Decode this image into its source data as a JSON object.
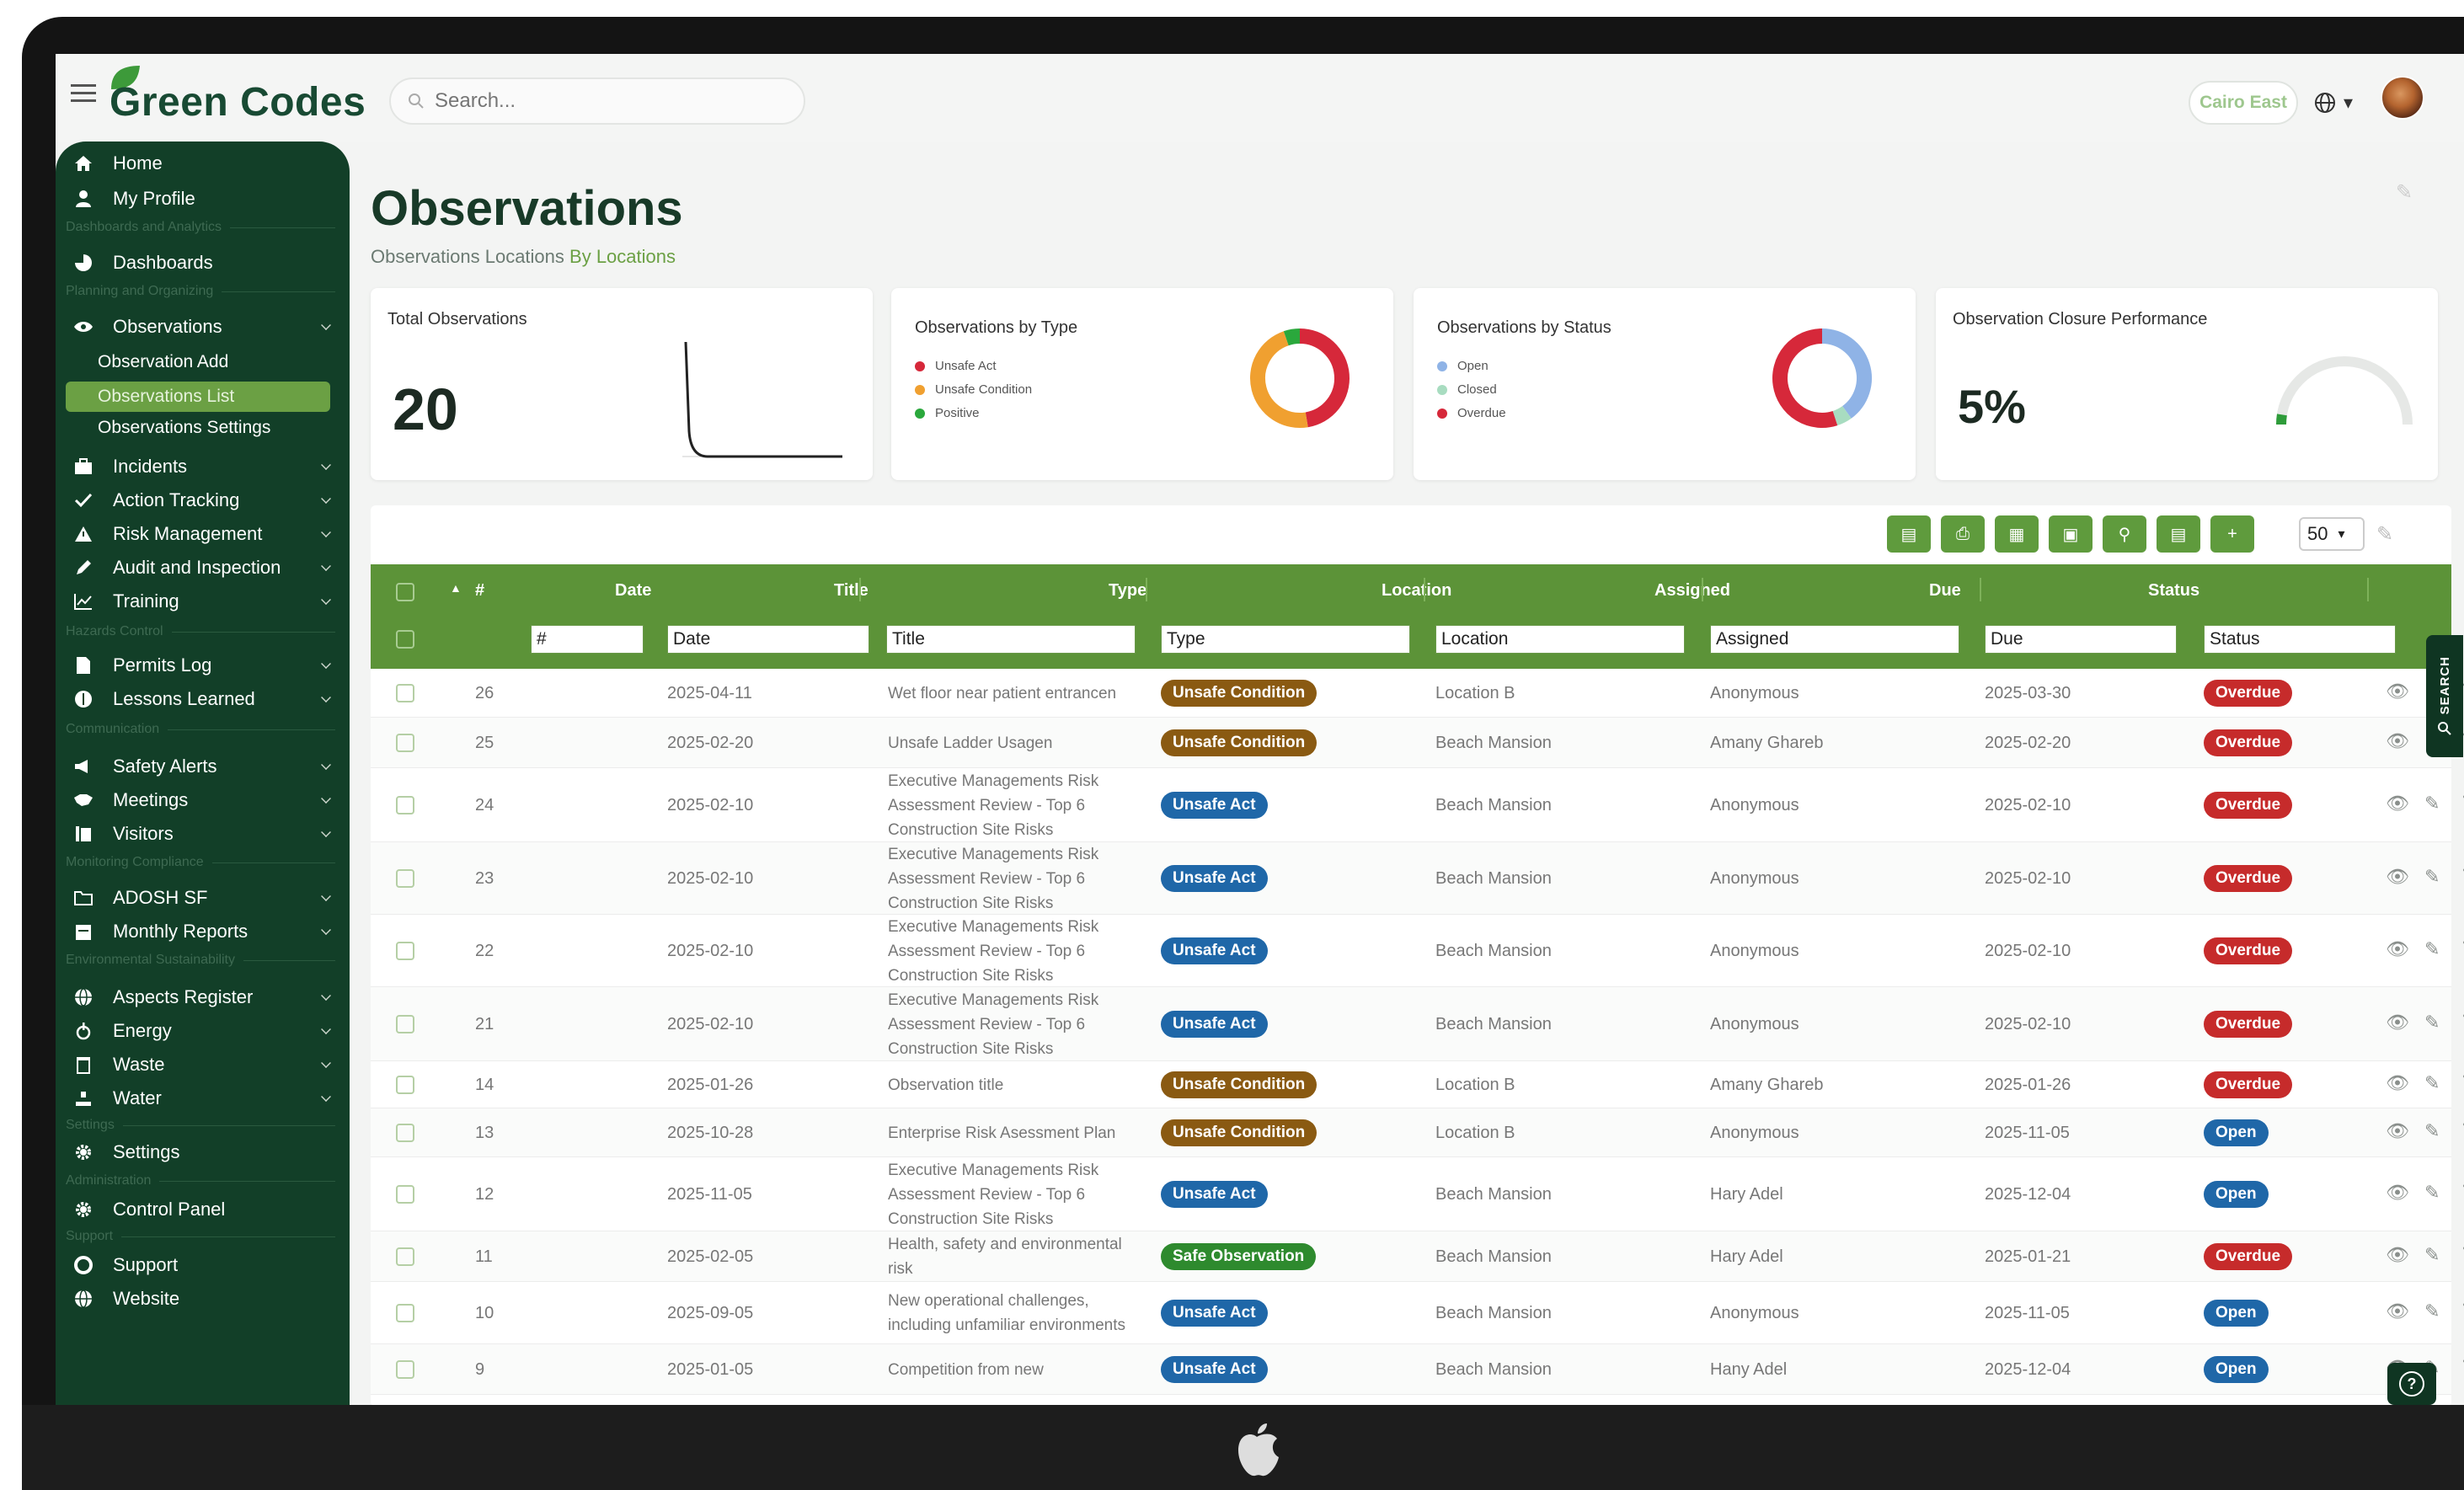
{
  "brand": {
    "name": "Green Codes"
  },
  "search": {
    "placeholder": "Search..."
  },
  "header": {
    "site": "Cairo East",
    "language_caret": "▾"
  },
  "sidebar": {
    "items": [
      {
        "label": "Home",
        "icon": "home-icon"
      },
      {
        "label": "My Profile",
        "icon": "user-icon"
      },
      {
        "label": "Dashboards",
        "icon": "dashboard-icon"
      },
      {
        "label": "Observations",
        "icon": "eye-icon"
      },
      {
        "label": "Incidents",
        "icon": "briefcase-icon"
      },
      {
        "label": "Action Tracking",
        "icon": "check-icon"
      },
      {
        "label": "Risk Management",
        "icon": "warning-icon"
      },
      {
        "label": "Audit and Inspection",
        "icon": "pen-icon"
      },
      {
        "label": "Training",
        "icon": "chart-icon"
      },
      {
        "label": "Permits Log",
        "icon": "file-icon"
      },
      {
        "label": "Lessons Learned",
        "icon": "lightbulb-icon"
      },
      {
        "label": "Safety Alerts",
        "icon": "megaphone-icon"
      },
      {
        "label": "Meetings",
        "icon": "handshake-icon"
      },
      {
        "label": "Visitors",
        "icon": "visitor-icon"
      },
      {
        "label": "ADOSH SF",
        "icon": "folder-icon"
      },
      {
        "label": "Monthly Reports",
        "icon": "calendar-icon"
      },
      {
        "label": "Aspects Register",
        "icon": "globe-icon"
      },
      {
        "label": "Energy",
        "icon": "energy-icon"
      },
      {
        "label": "Waste",
        "icon": "trash-icon"
      },
      {
        "label": "Water",
        "icon": "water-icon"
      },
      {
        "label": "Settings",
        "icon": "gear-icon"
      },
      {
        "label": "Control Panel",
        "icon": "gear-icon"
      },
      {
        "label": "Support",
        "icon": "support-icon"
      },
      {
        "label": "Website",
        "icon": "globe-icon"
      }
    ],
    "sub_items": [
      "Observation Add",
      "Observations List",
      "Observations Settings"
    ],
    "sections": [
      "Dashboards and Analytics",
      "Planning and Organizing",
      "Hazards Control",
      "Communication",
      "Monitoring Compliance",
      "Environmental Sustainability",
      "Settings",
      "Administration",
      "Support"
    ]
  },
  "page": {
    "title": "Observations",
    "crumb_prefix": "Observations Locations ",
    "crumb_link": "By Locations"
  },
  "cards": {
    "total": {
      "title": "Total Observations",
      "value": "20"
    },
    "by_type": {
      "title": "Observations by Type",
      "legend": [
        {
          "label": "Unsafe Act",
          "color": "#d6283a"
        },
        {
          "label": "Unsafe Condition",
          "color": "#f0a030"
        },
        {
          "label": "Positive",
          "color": "#2aa83c"
        }
      ]
    },
    "by_status": {
      "title": "Observations by Status",
      "legend": [
        {
          "label": "Open",
          "color": "#8fb3e6"
        },
        {
          "label": "Closed",
          "color": "#a8dcc0"
        },
        {
          "label": "Overdue",
          "color": "#d6283a"
        }
      ]
    },
    "closure": {
      "title": "Observation Closure Performance",
      "value": "5%",
      "fraction": 0.05
    }
  },
  "chart_data": [
    {
      "type": "pie",
      "title": "Observations by Type",
      "labels": [
        "Unsafe Act",
        "Unsafe Condition",
        "Positive"
      ],
      "values": [
        9,
        9,
        1
      ]
    },
    {
      "type": "pie",
      "title": "Observations by Status",
      "labels": [
        "Open",
        "Closed",
        "Overdue"
      ],
      "values": [
        8,
        1,
        11
      ]
    }
  ],
  "toolbar": {
    "per_page": "50"
  },
  "table": {
    "columns": [
      "#",
      "Date",
      "Title",
      "Type",
      "Location",
      "Assigned",
      "Due",
      "Status"
    ],
    "filters": [
      "#",
      "Date",
      "Title",
      "Type",
      "Location",
      "Assigned",
      "Due",
      "Status"
    ],
    "rows": [
      {
        "id": "26",
        "date": "2025-04-11",
        "title": "Wet floor near patient entrancen",
        "type": "Unsafe Condition",
        "location": "Location B",
        "assigned": "Anonymous",
        "due": "2025-03-30",
        "status": "Overdue"
      },
      {
        "id": "25",
        "date": "2025-02-20",
        "title": "Unsafe Ladder Usagen",
        "type": "Unsafe Condition",
        "location": "Beach Mansion",
        "assigned": "Amany Ghareb",
        "due": "2025-02-20",
        "status": "Overdue"
      },
      {
        "id": "24",
        "date": "2025-02-10",
        "title": "Executive Managements Risk Assessment Review - Top 6 Construction Site Risks",
        "type": "Unsafe Act",
        "location": "Beach Mansion",
        "assigned": "Anonymous",
        "due": "2025-02-10",
        "status": "Overdue"
      },
      {
        "id": "23",
        "date": "2025-02-10",
        "title": "Executive Managements Risk Assessment Review - Top 6 Construction Site Risks",
        "type": "Unsafe Act",
        "location": "Beach Mansion",
        "assigned": "Anonymous",
        "due": "2025-02-10",
        "status": "Overdue"
      },
      {
        "id": "22",
        "date": "2025-02-10",
        "title": "Executive Managements Risk Assessment Review - Top 6 Construction Site Risks",
        "type": "Unsafe Act",
        "location": "Beach Mansion",
        "assigned": "Anonymous",
        "due": "2025-02-10",
        "status": "Overdue"
      },
      {
        "id": "21",
        "date": "2025-02-10",
        "title": "Executive Managements Risk Assessment Review - Top 6 Construction Site Risks",
        "type": "Unsafe Act",
        "location": "Beach Mansion",
        "assigned": "Anonymous",
        "due": "2025-02-10",
        "status": "Overdue"
      },
      {
        "id": "14",
        "date": "2025-01-26",
        "title": "Observation title",
        "type": "Unsafe Condition",
        "location": "Location B",
        "assigned": "Amany Ghareb",
        "due": "2025-01-26",
        "status": "Overdue"
      },
      {
        "id": "13",
        "date": "2025-10-28",
        "title": "Enterprise Risk Asessment Plan",
        "type": "Unsafe Condition",
        "location": "Location B",
        "assigned": "Anonymous",
        "due": "2025-11-05",
        "status": "Open"
      },
      {
        "id": "12",
        "date": "2025-11-05",
        "title": "Executive Managements Risk Assessment Review - Top 6 Construction Site Risks",
        "type": "Unsafe Act",
        "location": "Beach Mansion",
        "assigned": "Hary Adel",
        "due": "2025-12-04",
        "status": "Open"
      },
      {
        "id": "11",
        "date": "2025-02-05",
        "title": "Health, safety and environmental risk",
        "type": "Safe Observation",
        "location": "Beach Mansion",
        "assigned": "Hary Adel",
        "due": "2025-01-21",
        "status": "Overdue"
      },
      {
        "id": "10",
        "date": "2025-09-05",
        "title": "New operational challenges, including unfamiliar environments",
        "type": "Unsafe Act",
        "location": "Beach Mansion",
        "assigned": "Anonymous",
        "due": "2025-11-05",
        "status": "Open"
      },
      {
        "id": "9",
        "date": "2025-01-05",
        "title": "Competition from new",
        "type": "Unsafe Act",
        "location": "Beach Mansion",
        "assigned": "Hany Adel",
        "due": "2025-12-04",
        "status": "Open"
      }
    ]
  },
  "widgets": {
    "search_tab": "SEARCH",
    "help": "?"
  }
}
